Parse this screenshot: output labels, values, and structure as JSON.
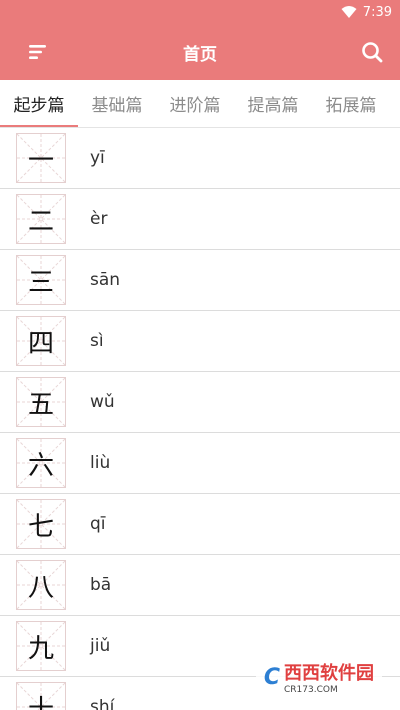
{
  "status_bar": {
    "time": "7:39"
  },
  "app_bar": {
    "title": "首页"
  },
  "tabs": [
    {
      "label": "起步篇",
      "active": true
    },
    {
      "label": "基础篇",
      "active": false
    },
    {
      "label": "进阶篇",
      "active": false
    },
    {
      "label": "提高篇",
      "active": false
    },
    {
      "label": "拓展篇",
      "active": false
    }
  ],
  "characters": [
    {
      "hanzi": "一",
      "pinyin": "yī"
    },
    {
      "hanzi": "二",
      "pinyin": "èr"
    },
    {
      "hanzi": "三",
      "pinyin": "sān"
    },
    {
      "hanzi": "四",
      "pinyin": "sì"
    },
    {
      "hanzi": "五",
      "pinyin": "wǔ"
    },
    {
      "hanzi": "六",
      "pinyin": "liù"
    },
    {
      "hanzi": "七",
      "pinyin": "qī"
    },
    {
      "hanzi": "八",
      "pinyin": "bā"
    },
    {
      "hanzi": "九",
      "pinyin": "jiǔ"
    },
    {
      "hanzi": "十",
      "pinyin": "shí"
    }
  ],
  "watermark": {
    "brand": "西西软件园",
    "site": "CR173.COM"
  },
  "colors": {
    "accent": "#ea7b7b"
  }
}
